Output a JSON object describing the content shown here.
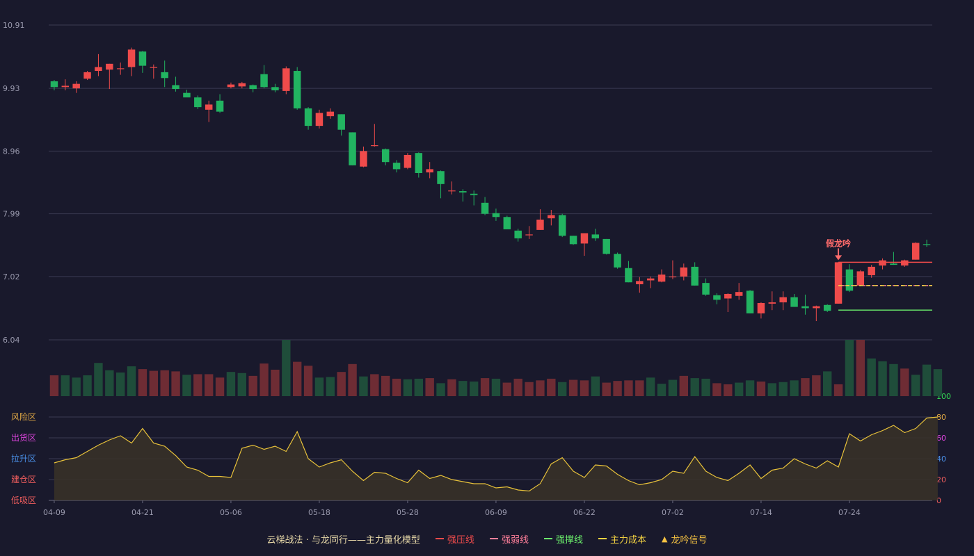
{
  "chart_data": {
    "type": "candlestick",
    "title": "",
    "legend": {
      "title": "云梯战法 · 与龙同行——主力量化模型",
      "entries": [
        {
          "label": "强压线",
          "color": "#ef4b4b",
          "style": "solid"
        },
        {
          "label": "强弱线",
          "color": "#ff7f9a",
          "style": "dashed"
        },
        {
          "label": "强撑线",
          "color": "#6cf06c",
          "style": "solid"
        },
        {
          "label": "主力成本",
          "color": "#f5d442",
          "style": "dashed"
        },
        {
          "label": "龙吟信号",
          "color": "#f5c242",
          "style": "triangle"
        }
      ],
      "position": "bottom"
    },
    "price_axis": {
      "ticks": [
        "10.91",
        "9.93",
        "8.96",
        "7.99",
        "7.02",
        "6.04"
      ],
      "ylim": [
        6.04,
        10.91
      ]
    },
    "x_ticks": [
      "04-09",
      "04-21",
      "05-06",
      "05-18",
      "05-28",
      "06-09",
      "06-22",
      "07-02",
      "07-14",
      "07-24"
    ],
    "x_tick_index": [
      0,
      8,
      16,
      24,
      32,
      40,
      48,
      56,
      64,
      72
    ],
    "up_color": "#ef4b4b",
    "down_color": "#22b461",
    "candles": [
      [
        10.04,
        9.95,
        10.06,
        9.9
      ],
      [
        9.95,
        9.97,
        10.07,
        9.9
      ],
      [
        9.93,
        10.0,
        10.04,
        9.86
      ],
      [
        10.08,
        10.18,
        10.2,
        10.06
      ],
      [
        10.2,
        10.26,
        10.46,
        10.12
      ],
      [
        10.22,
        10.31,
        10.31,
        9.92
      ],
      [
        10.24,
        10.24,
        10.33,
        10.14
      ],
      [
        10.26,
        10.53,
        10.56,
        10.12
      ],
      [
        10.5,
        10.28,
        10.51,
        10.17
      ],
      [
        10.26,
        10.26,
        10.3,
        10.08
      ],
      [
        10.18,
        10.09,
        10.36,
        9.95
      ],
      [
        9.98,
        9.92,
        10.11,
        9.88
      ],
      [
        9.86,
        9.79,
        9.91,
        9.8
      ],
      [
        9.79,
        9.64,
        9.82,
        9.61
      ],
      [
        9.6,
        9.68,
        9.74,
        9.41
      ],
      [
        9.74,
        9.57,
        9.84,
        9.55
      ],
      [
        9.95,
        9.99,
        10.02,
        9.93
      ],
      [
        9.96,
        10.01,
        10.03,
        9.93
      ],
      [
        9.98,
        9.92,
        9.99,
        9.87
      ],
      [
        10.15,
        9.95,
        10.29,
        9.93
      ],
      [
        9.95,
        9.9,
        10.0,
        9.87
      ],
      [
        9.89,
        10.24,
        10.27,
        9.84
      ],
      [
        10.2,
        9.62,
        10.26,
        9.6
      ],
      [
        9.62,
        9.35,
        9.64,
        9.29
      ],
      [
        9.35,
        9.55,
        9.6,
        9.31
      ],
      [
        9.5,
        9.57,
        9.62,
        9.46
      ],
      [
        9.53,
        9.29,
        9.53,
        9.2
      ],
      [
        9.25,
        8.74,
        9.25,
        8.74
      ],
      [
        8.72,
        8.96,
        9.03,
        8.71
      ],
      [
        9.05,
        9.05,
        9.38,
        9.03
      ],
      [
        8.99,
        8.79,
        9.0,
        8.74
      ],
      [
        8.78,
        8.68,
        8.82,
        8.63
      ],
      [
        8.7,
        8.9,
        8.93,
        8.68
      ],
      [
        8.93,
        8.62,
        8.94,
        8.55
      ],
      [
        8.63,
        8.68,
        8.79,
        8.54
      ],
      [
        8.65,
        8.45,
        8.66,
        8.23
      ],
      [
        8.35,
        8.35,
        8.49,
        8.29
      ],
      [
        8.34,
        8.32,
        8.37,
        8.18
      ],
      [
        8.3,
        8.28,
        8.35,
        8.12
      ],
      [
        8.16,
        7.99,
        8.25,
        7.97
      ],
      [
        8.0,
        7.94,
        8.07,
        7.88
      ],
      [
        7.94,
        7.75,
        7.96,
        7.75
      ],
      [
        7.73,
        7.61,
        7.76,
        7.56
      ],
      [
        7.67,
        7.67,
        7.8,
        7.6
      ],
      [
        7.74,
        7.9,
        8.06,
        7.74
      ],
      [
        7.92,
        7.97,
        8.05,
        7.81
      ],
      [
        7.97,
        7.65,
        7.99,
        7.63
      ],
      [
        7.65,
        7.52,
        7.65,
        7.51
      ],
      [
        7.53,
        7.69,
        7.69,
        7.34
      ],
      [
        7.67,
        7.61,
        7.76,
        7.57
      ],
      [
        7.6,
        7.37,
        7.6,
        7.36
      ],
      [
        7.37,
        7.16,
        7.39,
        7.14
      ],
      [
        7.15,
        6.93,
        7.26,
        6.93
      ],
      [
        6.9,
        6.95,
        7.01,
        6.77
      ],
      [
        6.96,
        6.99,
        7.02,
        6.84
      ],
      [
        6.94,
        7.05,
        7.13,
        6.93
      ],
      [
        7.02,
        7.02,
        7.27,
        6.98
      ],
      [
        7.02,
        7.16,
        7.22,
        6.96
      ],
      [
        7.17,
        6.88,
        7.24,
        6.88
      ],
      [
        6.92,
        6.74,
        6.99,
        6.72
      ],
      [
        6.73,
        6.66,
        6.76,
        6.59
      ],
      [
        6.68,
        6.75,
        6.76,
        6.47
      ],
      [
        6.72,
        6.78,
        6.92,
        6.66
      ],
      [
        6.8,
        6.45,
        6.81,
        6.45
      ],
      [
        6.45,
        6.61,
        6.62,
        6.37
      ],
      [
        6.6,
        6.62,
        6.79,
        6.5
      ],
      [
        6.62,
        6.7,
        6.79,
        6.5
      ],
      [
        6.7,
        6.55,
        6.75,
        6.55
      ],
      [
        6.56,
        6.53,
        6.74,
        6.43
      ],
      [
        6.53,
        6.56,
        6.57,
        6.33
      ],
      [
        6.58,
        6.49,
        6.59,
        6.47
      ],
      [
        6.6,
        7.24,
        7.24,
        6.6
      ],
      [
        7.13,
        6.8,
        7.21,
        6.78
      ],
      [
        6.88,
        7.1,
        7.12,
        6.87
      ],
      [
        7.04,
        7.17,
        7.2,
        7.0
      ],
      [
        7.19,
        7.27,
        7.3,
        7.13
      ],
      [
        7.22,
        7.2,
        7.4,
        7.2
      ],
      [
        7.19,
        7.27,
        7.28,
        7.17
      ],
      [
        7.28,
        7.54,
        7.55,
        7.28
      ],
      [
        7.52,
        7.51,
        7.59,
        7.48
      ]
    ],
    "volume": [
      {
        "v": 37,
        "up": 1
      },
      {
        "v": 37,
        "up": 0
      },
      {
        "v": 33,
        "up": 0
      },
      {
        "v": 37,
        "up": 0
      },
      {
        "v": 59,
        "up": 0
      },
      {
        "v": 46,
        "up": 0
      },
      {
        "v": 42,
        "up": 0
      },
      {
        "v": 53,
        "up": 0
      },
      {
        "v": 48,
        "up": 1
      },
      {
        "v": 45,
        "up": 1
      },
      {
        "v": 46,
        "up": 1
      },
      {
        "v": 44,
        "up": 1
      },
      {
        "v": 38,
        "up": 0
      },
      {
        "v": 39,
        "up": 1
      },
      {
        "v": 39,
        "up": 1
      },
      {
        "v": 33,
        "up": 1
      },
      {
        "v": 43,
        "up": 0
      },
      {
        "v": 41,
        "up": 0
      },
      {
        "v": 36,
        "up": 1
      },
      {
        "v": 58,
        "up": 1
      },
      {
        "v": 47,
        "up": 1
      },
      {
        "v": 100,
        "up": 0
      },
      {
        "v": 61,
        "up": 1
      },
      {
        "v": 54,
        "up": 1
      },
      {
        "v": 33,
        "up": 0
      },
      {
        "v": 34,
        "up": 0
      },
      {
        "v": 43,
        "up": 1
      },
      {
        "v": 57,
        "up": 1
      },
      {
        "v": 35,
        "up": 0
      },
      {
        "v": 39,
        "up": 1
      },
      {
        "v": 36,
        "up": 1
      },
      {
        "v": 31,
        "up": 1
      },
      {
        "v": 30,
        "up": 0
      },
      {
        "v": 31,
        "up": 0
      },
      {
        "v": 32,
        "up": 1
      },
      {
        "v": 23,
        "up": 0
      },
      {
        "v": 30,
        "up": 1
      },
      {
        "v": 27,
        "up": 0
      },
      {
        "v": 26,
        "up": 0
      },
      {
        "v": 32,
        "up": 1
      },
      {
        "v": 31,
        "up": 0
      },
      {
        "v": 24,
        "up": 1
      },
      {
        "v": 31,
        "up": 1
      },
      {
        "v": 25,
        "up": 1
      },
      {
        "v": 28,
        "up": 1
      },
      {
        "v": 31,
        "up": 1
      },
      {
        "v": 25,
        "up": 0
      },
      {
        "v": 29,
        "up": 1
      },
      {
        "v": 28,
        "up": 1
      },
      {
        "v": 35,
        "up": 0
      },
      {
        "v": 24,
        "up": 1
      },
      {
        "v": 27,
        "up": 1
      },
      {
        "v": 28,
        "up": 1
      },
      {
        "v": 28,
        "up": 1
      },
      {
        "v": 33,
        "up": 0
      },
      {
        "v": 22,
        "up": 0
      },
      {
        "v": 29,
        "up": 0
      },
      {
        "v": 36,
        "up": 1
      },
      {
        "v": 32,
        "up": 0
      },
      {
        "v": 31,
        "up": 0
      },
      {
        "v": 23,
        "up": 1
      },
      {
        "v": 21,
        "up": 1
      },
      {
        "v": 24,
        "up": 0
      },
      {
        "v": 28,
        "up": 0
      },
      {
        "v": 26,
        "up": 1
      },
      {
        "v": 23,
        "up": 0
      },
      {
        "v": 25,
        "up": 0
      },
      {
        "v": 28,
        "up": 0
      },
      {
        "v": 32,
        "up": 1
      },
      {
        "v": 37,
        "up": 1
      },
      {
        "v": 44,
        "up": 0
      },
      {
        "v": 21,
        "up": 1
      },
      {
        "v": 100,
        "up": 0
      },
      {
        "v": 100,
        "up": 1
      },
      {
        "v": 67,
        "up": 0
      },
      {
        "v": 62,
        "up": 0
      },
      {
        "v": 57,
        "up": 0
      },
      {
        "v": 49,
        "up": 1
      },
      {
        "v": 38,
        "up": 0
      },
      {
        "v": 56,
        "up": 0
      },
      {
        "v": 48,
        "up": 0
      }
    ],
    "oscillator": {
      "values": [
        36,
        39,
        41,
        47,
        53,
        58,
        62,
        55,
        69,
        55,
        52,
        43,
        32,
        29,
        23,
        23,
        22,
        50,
        53,
        49,
        52,
        47,
        66,
        40,
        32,
        36,
        39,
        28,
        19,
        27,
        26,
        21,
        17,
        29,
        21,
        24,
        20,
        18,
        16,
        16,
        12,
        13,
        10,
        9,
        16,
        35,
        41,
        28,
        22,
        34,
        33,
        25,
        19,
        15,
        17,
        20,
        28,
        26,
        42,
        28,
        22,
        19,
        26,
        34,
        21,
        29,
        31,
        40,
        35,
        31,
        38,
        32,
        64,
        57,
        63,
        67,
        72,
        65,
        69,
        79,
        80
      ],
      "ylim": [
        0,
        100
      ],
      "right_ticks": [
        {
          "label": "100",
          "value": 100,
          "color": "#33dd55"
        },
        {
          "label": "80",
          "value": 80,
          "color": "#e0a845"
        },
        {
          "label": "60",
          "value": 60,
          "color": "#dd44dd"
        },
        {
          "label": "40",
          "value": 40,
          "color": "#4a90e8"
        },
        {
          "label": "20",
          "value": 20,
          "color": "#ef5d5d"
        },
        {
          "label": "0",
          "value": 0,
          "color": "#ef5d5d"
        }
      ],
      "zones": [
        {
          "label": "风险区",
          "value": 80,
          "color": "#e0a845"
        },
        {
          "label": "出货区",
          "value": 60,
          "color": "#dd44dd"
        },
        {
          "label": "拉升区",
          "value": 40,
          "color": "#4a90e8"
        },
        {
          "label": "建仓区",
          "value": 20,
          "color": "#ef5d5d"
        },
        {
          "label": "低吸区",
          "value": 0,
          "color": "#ef5d5d"
        }
      ]
    },
    "signal": {
      "label": "假龙吟",
      "index": 71
    },
    "levels": [
      {
        "name": "强压线",
        "price": 7.24,
        "start_index": 71,
        "color": "#ef4b4b"
      },
      {
        "name": "强弱线",
        "price": 6.88,
        "start_index": 71,
        "color": "#ff7f9a"
      },
      {
        "name": "主力成本",
        "price": 6.88,
        "start_index": 71,
        "color": "#f5d442"
      },
      {
        "name": "强撑线",
        "price": 6.5,
        "start_index": 71,
        "color": "#6cf06c"
      }
    ]
  }
}
